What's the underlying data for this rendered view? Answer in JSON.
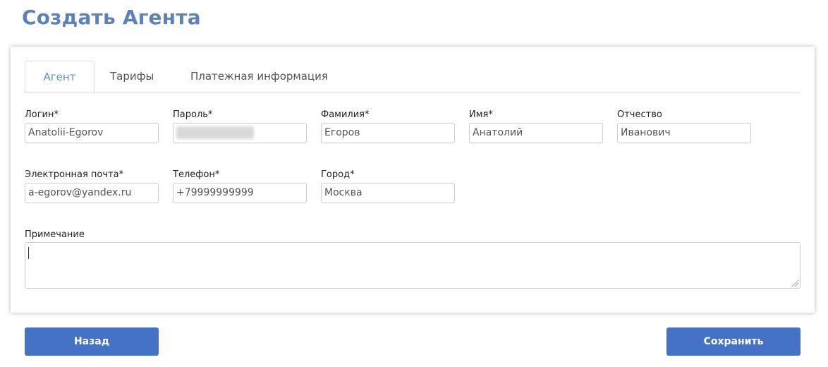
{
  "page": {
    "title": "Создать Агента"
  },
  "tabs": [
    {
      "label": "Агент",
      "active": true
    },
    {
      "label": "Тарифы",
      "active": false
    },
    {
      "label": "Платежная информация",
      "active": false
    }
  ],
  "form": {
    "login": {
      "label": "Логин*",
      "value": "Anatolii-Egorov"
    },
    "password": {
      "label": "Пароль*",
      "value": ""
    },
    "last_name": {
      "label": "Фамилия*",
      "value": "Егоров"
    },
    "first_name": {
      "label": "Имя*",
      "value": "Анатолий"
    },
    "patronymic": {
      "label": "Отчество",
      "value": "Иванович"
    },
    "email": {
      "label": "Электронная почта*",
      "value": "a-egorov@yandex.ru"
    },
    "phone": {
      "label": "Телефон*",
      "value": "+79999999999"
    },
    "city": {
      "label": "Город*",
      "value": "Москва"
    },
    "note": {
      "label": "Примечание",
      "value": ""
    }
  },
  "buttons": {
    "back": "Назад",
    "save": "Сохранить"
  },
  "colors": {
    "title": "#5b83b7",
    "tab_active": "#5b8fd0",
    "button": "#4472c4"
  }
}
